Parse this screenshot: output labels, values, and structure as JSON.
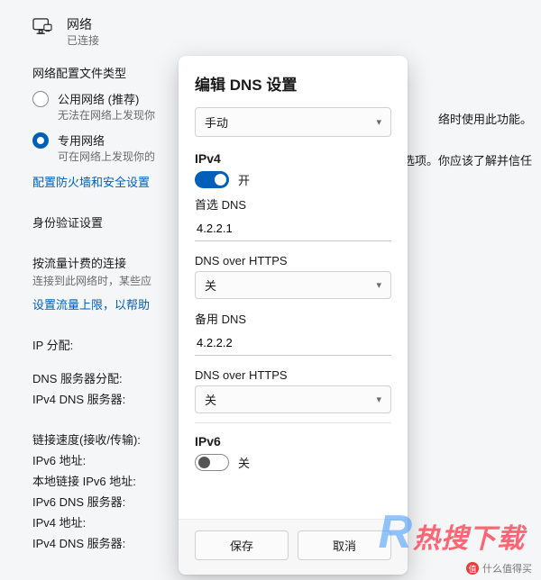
{
  "header": {
    "title": "网络",
    "subtitle": "已连接"
  },
  "profile_section": {
    "label": "网络配置文件类型",
    "public_label": "公用网络 (推荐)",
    "public_desc": "无法在网络上发现你",
    "private_label": "专用网络",
    "private_desc": "可在网络上发现你的",
    "firewall_link": "配置防火墙和安全设置"
  },
  "auth_section": {
    "label": "身份验证设置"
  },
  "metered_section": {
    "label": "按流量计费的连接",
    "desc": "连接到此网络时，某些应",
    "limit_link": "设置流量上限，以帮助"
  },
  "ip_section": {
    "label": "IP 分配:",
    "dns_alloc": "DNS 服务器分配:",
    "ipv4_dns": "IPv4 DNS 服务器:"
  },
  "link_section": {
    "label": "链接速度(接收/传输):",
    "ipv6_addr": "IPv6 地址:",
    "local_ipv6": "本地链接 IPv6 地址:",
    "ipv6_dns": "IPv6 DNS 服务器:",
    "ipv4_addr": "IPv4 地址:",
    "ipv4_dns": "IPv4 DNS 服务器:"
  },
  "right_text": {
    "line1": "络时使用此功能。",
    "line2": "选择此选项。你应该了解并信任"
  },
  "modal": {
    "title": "编辑 DNS 设置",
    "mode_value": "手动",
    "ipv4": {
      "heading": "IPv4",
      "toggle_state": "开",
      "preferred_label": "首选 DNS",
      "preferred_value": "4.2.2.1",
      "doh_label": "DNS over HTTPS",
      "doh_value": "关",
      "alt_label": "备用 DNS",
      "alt_value": "4.2.2.2",
      "alt_doh_label": "DNS over HTTPS",
      "alt_doh_value": "关"
    },
    "ipv6": {
      "heading": "IPv6",
      "toggle_state": "关"
    },
    "save": "保存",
    "cancel": "取消"
  },
  "watermark": {
    "text": "热搜下载",
    "smdm": "什么值得买"
  }
}
